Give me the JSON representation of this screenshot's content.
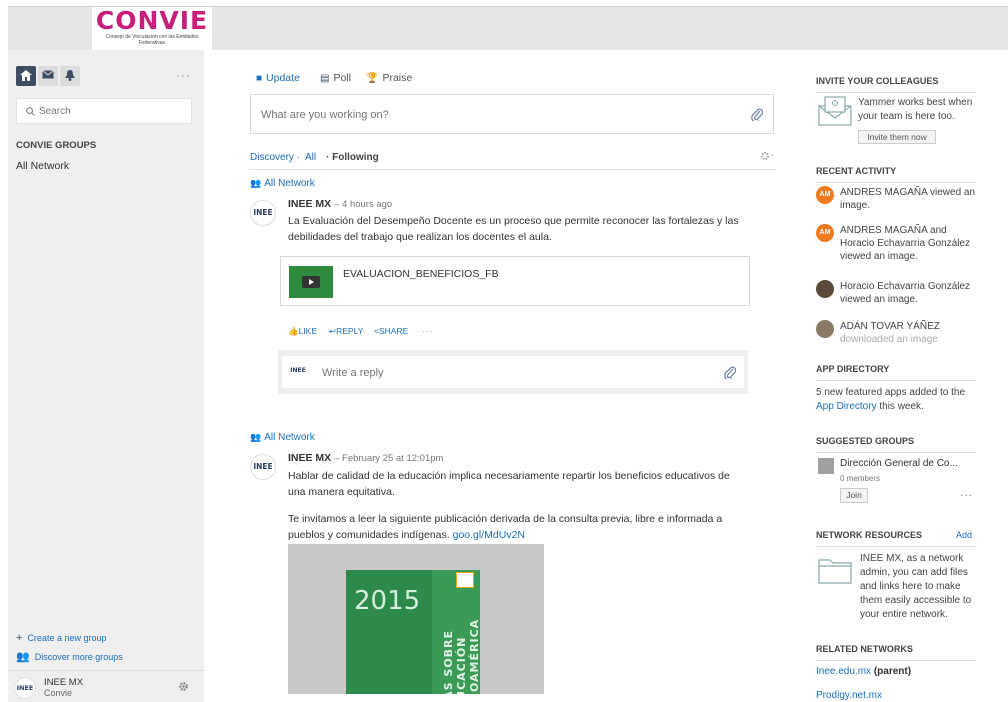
{
  "logo": {
    "word": "CONVIE",
    "subtitle": "Consejo de Vinculación con las Entidades Federativas"
  },
  "sidebar": {
    "search_placeholder": "Search",
    "groups_title": "CONVIE GROUPS",
    "all_network": "All Network",
    "create_group": "Create a new group",
    "discover_groups": "Discover more groups",
    "user_name": "INEE MX",
    "user_network": "Convie",
    "more": "···"
  },
  "publisher": {
    "tab_update": "Update",
    "tab_poll": "Poll",
    "tab_praise": "Praise",
    "placeholder": "What are you working on?"
  },
  "filter": {
    "discovery": "Discovery ·",
    "all": "All",
    "following": "· Following"
  },
  "posts": [
    {
      "group": "All Network",
      "author": "INEE MX",
      "time": "– 4 hours ago",
      "body": "La Evaluación del Desempeño Docente es un proceso que permite reconocer las fortalezas y las debilidades del trabajo que realizan los docentes el aula.",
      "attachment": "EVALUACION_BENEFICIOS_FB",
      "like": "LIKE",
      "reply": "REPLY",
      "share": "SHARE",
      "more": "···",
      "reply_placeholder": "Write a reply"
    },
    {
      "group": "All Network",
      "author": "INEE MX",
      "time": "– February 25 at 12:01pm",
      "body_p1": "Hablar de calidad de la educación implica necesariamente repartir los beneficios educativos de una manera equitativa.",
      "body_p2": "Te invitamos a leer la siguiente publicación derivada de la consulta previa, libre e informada a pueblos y comunidades indígenas.",
      "link": "goo.gl/MdUv2N",
      "image_year": "2015",
      "image_spine": "DAS SOBRE DUCACIÓN EROAMÉRICA"
    }
  ],
  "rail": {
    "invite_title": "INVITE YOUR COLLEAGUES",
    "invite_text": "Yammer works best when your team is here too.",
    "invite_button": "Invite them now",
    "recent_title": "RECENT ACTIVITY",
    "activity": [
      {
        "avatar": "AM",
        "text": "ANDRES MAGAÑA viewed an image."
      },
      {
        "avatar": "AM",
        "text": "ANDRES MAGAÑA and Horacio Echavarria González viewed an image."
      },
      {
        "avatar": "",
        "text": "Horacio Echavarria González viewed an image."
      },
      {
        "avatar": "",
        "text": "ADÁN TOVAR YÁÑEZ",
        "fade": "downloaded an image"
      }
    ],
    "app_title": "APP DIRECTORY",
    "app_text": "5 new featured apps added to the",
    "app_link": "App Directory",
    "app_text2": "this week.",
    "suggested_title": "SUGGESTED GROUPS",
    "suggested_name": "Dirección General de Co...",
    "suggested_members": "0 members",
    "join": "Join",
    "suggested_more": "···",
    "resources_title": "NETWORK RESOURCES",
    "resources_add": "Add",
    "resources_text": "INEE MX, as a network admin, you can add files and links here to make them easily accessible to your entire network.",
    "related_title": "RELATED NETWORKS",
    "related_1": "Inee.edu.mx",
    "related_1_suffix": "(parent)",
    "related_2": "Prodigy.net.mx"
  },
  "colors": {
    "accent": "#1a6eb8",
    "brand": "#c81f7d",
    "nav_dark": "#3d4e63",
    "activity_avatar": "#f07a1f"
  }
}
